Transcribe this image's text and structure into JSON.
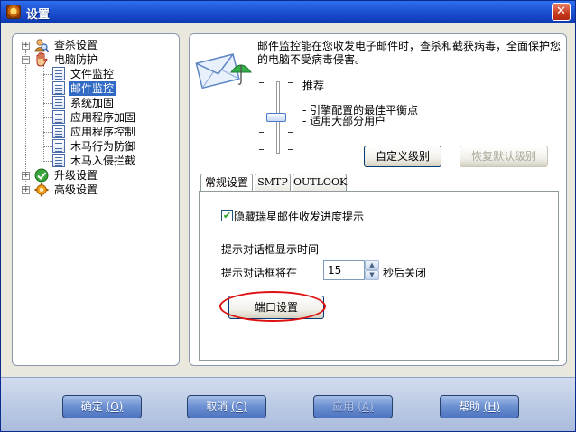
{
  "window": {
    "title": "设置",
    "close_glyph": "✕"
  },
  "tree": {
    "items": [
      {
        "label": "查杀设置",
        "expander": "+",
        "icon": "user-search-icon"
      },
      {
        "label": "电脑防护",
        "expander": "−",
        "icon": "hand-shield-icon"
      },
      {
        "label": "文件监控",
        "icon": "document-icon"
      },
      {
        "label": "邮件监控",
        "icon": "document-icon",
        "selected": true
      },
      {
        "label": "系统加固",
        "icon": "document-icon"
      },
      {
        "label": "应用程序加固",
        "icon": "document-icon"
      },
      {
        "label": "应用程序控制",
        "icon": "document-icon"
      },
      {
        "label": "木马行为防御",
        "icon": "document-icon"
      },
      {
        "label": "木马入侵拦截",
        "icon": "document-icon"
      },
      {
        "label": "升级设置",
        "expander": "+",
        "icon": "green-check-icon"
      },
      {
        "label": "高级设置",
        "expander": "+",
        "icon": "gear-icon"
      }
    ]
  },
  "header": {
    "description": "邮件监控能在您收发电子邮件时，查杀和截获病毒，全面保护您的电脑不受病毒侵害。",
    "icon": "mail-umbrella-icon"
  },
  "level": {
    "name": "推荐",
    "desc_line1": "- 引擎配置的最佳平衡点",
    "desc_line2": "- 适用大部分用户",
    "custom_button": "自定义级别",
    "restore_button": "恢复默认级别"
  },
  "tabs": [
    {
      "label": "常规设置",
      "active": true
    },
    {
      "label": "SMTP"
    },
    {
      "label": "OUTLOOK"
    }
  ],
  "general": {
    "hide_progress_label": "隐藏瑞星邮件收发进度提示",
    "hide_progress_checked": true,
    "check_glyph": "✔",
    "dialog_time_heading": "提示对话框显示时间",
    "close_prefix": "提示对话框将在",
    "close_seconds": "15",
    "close_suffix": "秒后关闭",
    "port_button": "端口设置"
  },
  "footer": {
    "ok": "确定",
    "ok_key": "(O)",
    "cancel": "取消",
    "cancel_key": "(C)",
    "apply": "应用",
    "apply_key": "(A)",
    "help": "帮助",
    "help_key": "(H)"
  },
  "colors": {
    "title_bar": "#1f56d6",
    "selection": "#316ac5",
    "highlight_oval": "#dd1111"
  }
}
